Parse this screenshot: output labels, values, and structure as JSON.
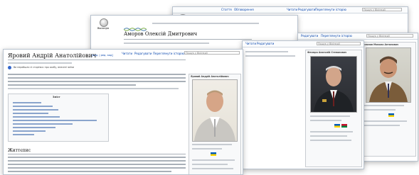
{
  "sidebar_wordmark": "Вікіпедія",
  "people": [
    {
      "name": "Аморов Олексій Дмитрович",
      "infobox_title": "Аморов Олексій Дмитрович"
    },
    {
      "name": "Яровий Андрій Анатолійович",
      "infobox_title": "Яровий Андрій Анатолійович"
    },
    {
      "name": "Фесюра Анатолій Степанович",
      "infobox_title": "Фесюра Анатолій Степанович"
    },
    {
      "name": "Місюмов Микола Антонович",
      "infobox_title": "Місюмов Микола Антонович"
    }
  ],
  "tabs": {
    "article": "Стаття",
    "discussion": "Обговорення",
    "read": "Читати",
    "edit": "Редагувати",
    "history": "Переглянути історію"
  },
  "search_placeholder": "Пошук у Вікіпедії",
  "notice": "Ви перейшли зі сторінки: про особу, внесені зміни",
  "toc_title": "Зміст",
  "section_heading": "Життєпис",
  "edit_links": "[ред. | ред. код]",
  "colors": {
    "link": "#0645ad",
    "card_border": "#b9c3cf",
    "text": "#111111"
  }
}
